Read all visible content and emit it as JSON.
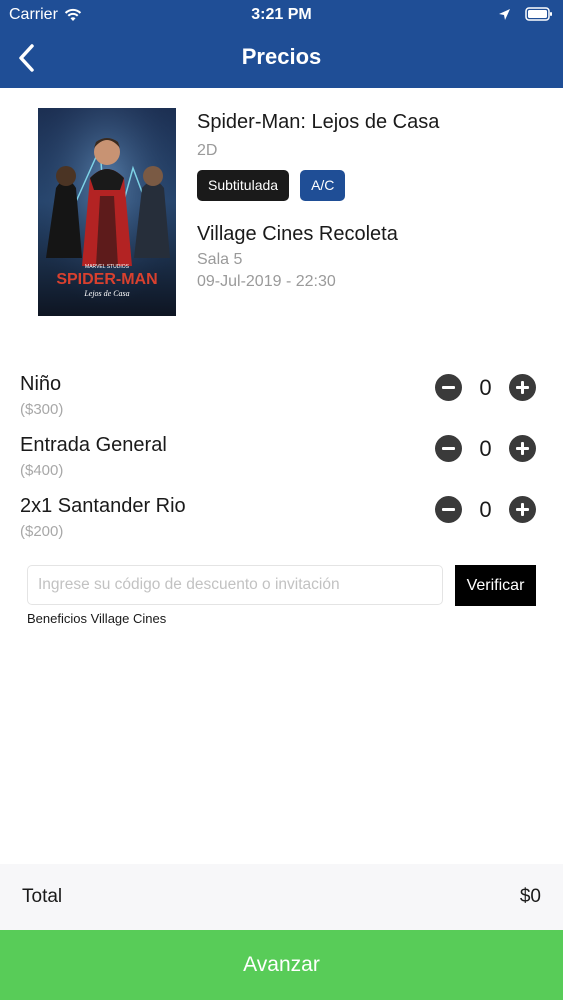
{
  "status_bar": {
    "carrier": "Carrier",
    "time": "3:21 PM"
  },
  "nav": {
    "title": "Precios"
  },
  "movie": {
    "title": "Spider-Man: Lejos de Casa",
    "format": "2D",
    "badges": [
      "Subtitulada",
      "A/C"
    ],
    "cinema": "Village Cines Recoleta",
    "room": "Sala 5",
    "datetime": "09-Jul-2019 - 22:30",
    "poster": {
      "brand": "MARVEL STUDIOS",
      "title": "SPIDER-MAN",
      "subtitle": "Lejos de Casa"
    }
  },
  "tickets": [
    {
      "name": "Niño",
      "price": "($300)",
      "quantity": "0"
    },
    {
      "name": "Entrada General",
      "price": "($400)",
      "quantity": "0"
    },
    {
      "name": "2x1 Santander Rio",
      "price": "($200)",
      "quantity": "0"
    }
  ],
  "discount": {
    "placeholder": "Ingrese su código de descuento o invitación",
    "value": "",
    "verify_label": "Verificar",
    "benefits_link": "Beneficios Village Cines"
  },
  "footer": {
    "total_label": "Total",
    "total_value": "$0",
    "advance_label": "Avanzar"
  },
  "colors": {
    "header": "#1f4e96",
    "advance": "#58cc58",
    "badge_dark": "#1a1a1a",
    "badge_blue": "#1f4e96"
  }
}
